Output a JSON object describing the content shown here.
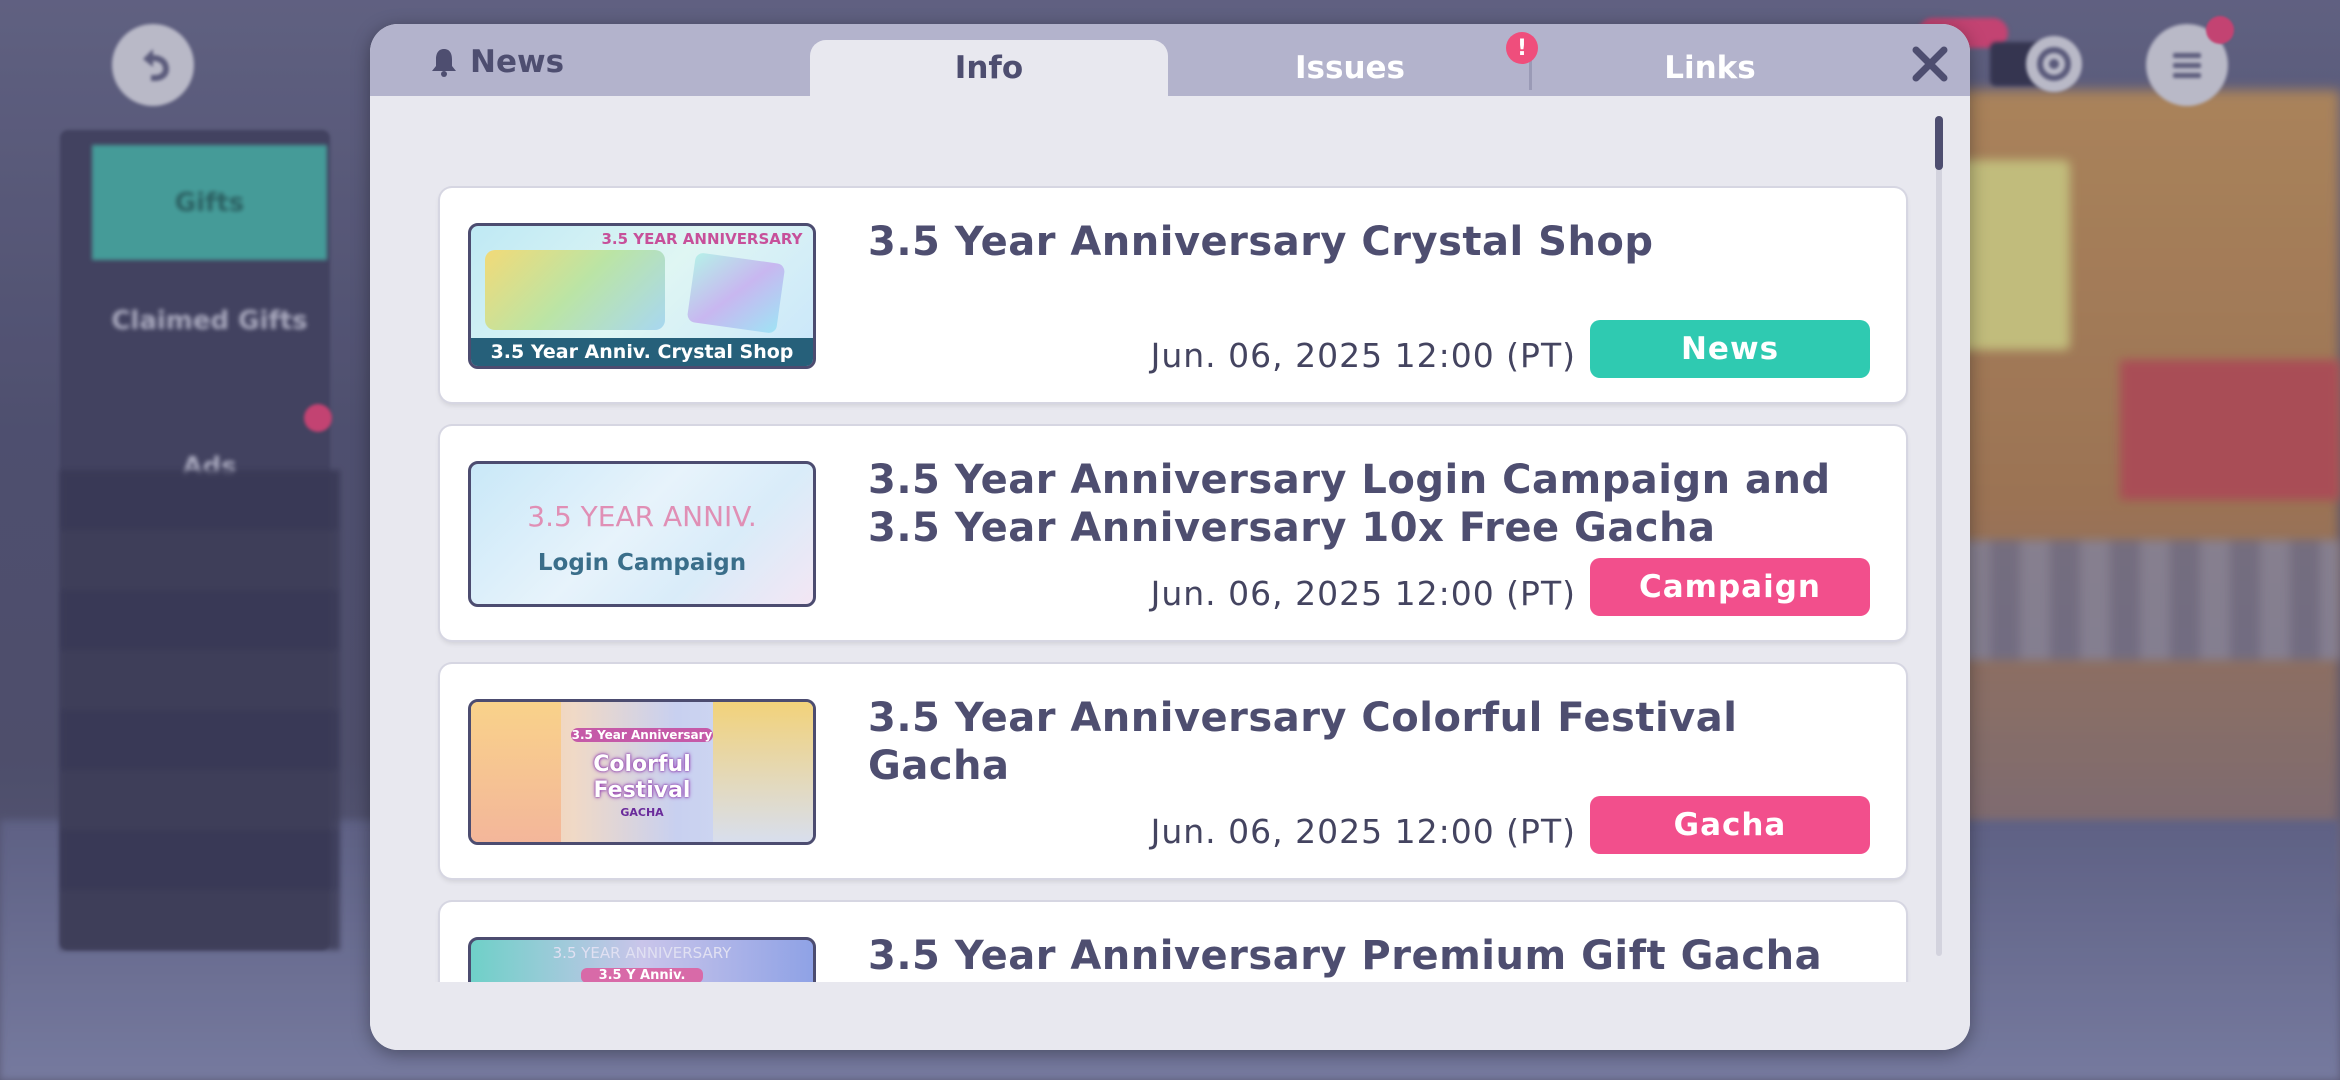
{
  "background": {
    "left_menu": {
      "gifts": "Gifts",
      "claimed_gifts": "Claimed Gifts",
      "ads": "Ads"
    }
  },
  "modal": {
    "tabs": {
      "news": "News",
      "info": "Info",
      "issues": "Issues",
      "links": "Links"
    },
    "issues_badge": "!",
    "active_tab": "Info",
    "items": [
      {
        "title": "3.5 Year Anniversary Crystal Shop",
        "date": "Jun. 06, 2025 12:00 (PT)",
        "tag": "News",
        "tag_color": "#2fcab1",
        "thumb_top": "3.5 YEAR ANNIVERSARY",
        "thumb_caption": "3.5 Year Anniv. Crystal Shop"
      },
      {
        "title": "3.5 Year Anniversary Login Campaign and 3.5 Year Anniversary 10x Free Gacha",
        "date": "Jun. 06, 2025 12:00 (PT)",
        "tag": "Campaign",
        "tag_color": "#f24f8c",
        "thumb_top": "3.5 YEAR ANNIV.",
        "thumb_caption": "Login Campaign"
      },
      {
        "title": "3.5 Year Anniversary Colorful Festival Gacha",
        "date": "Jun. 06, 2025 12:00 (PT)",
        "tag": "Gacha",
        "tag_color": "#f24f8c",
        "thumb_top": "3.5 Year Anniversary",
        "thumb_caption": "Colorful Festival",
        "thumb_sub": "GACHA"
      },
      {
        "title": "3.5 Year Anniversary Premium Gift Gacha",
        "thumb_top": "3.5 YEAR ANNIVERSARY",
        "thumb_caption": "3.5 Y Anniv."
      }
    ]
  },
  "icons": {
    "back": "back-arrow-icon",
    "settings": "gear-icon",
    "menu": "hamburger-menu-icon",
    "bell": "bell-icon",
    "close": "close-icon"
  }
}
